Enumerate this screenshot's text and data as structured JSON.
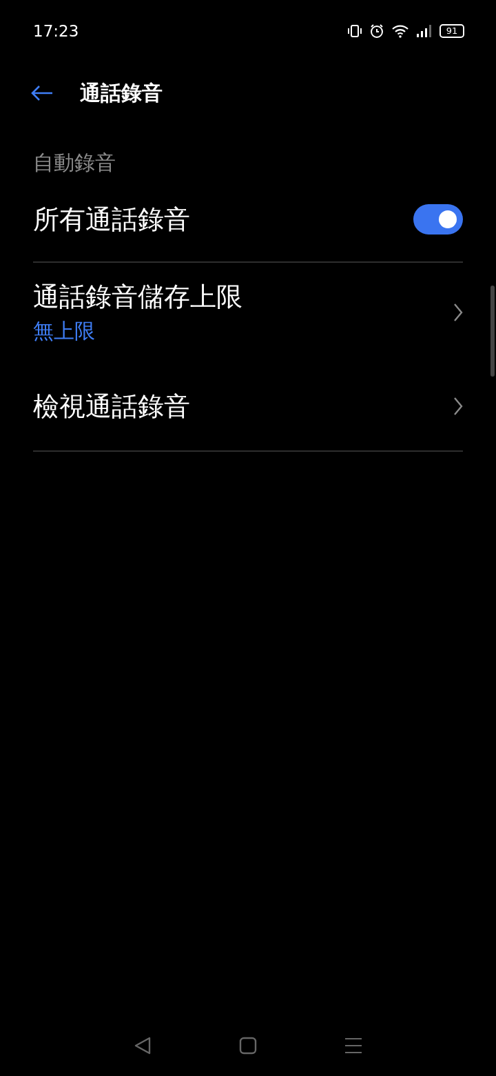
{
  "status_bar": {
    "time": "17:23",
    "battery": "91"
  },
  "header": {
    "title": "通話錄音"
  },
  "section": {
    "title": "自動錄音"
  },
  "items": [
    {
      "kind": "switch",
      "label": "所有通話錄音",
      "on": true
    },
    {
      "kind": "divider"
    },
    {
      "kind": "link",
      "label": "通話錄音儲存上限",
      "value": "無上限"
    },
    {
      "kind": "link",
      "label": "檢視通話錄音"
    },
    {
      "kind": "divider"
    }
  ]
}
